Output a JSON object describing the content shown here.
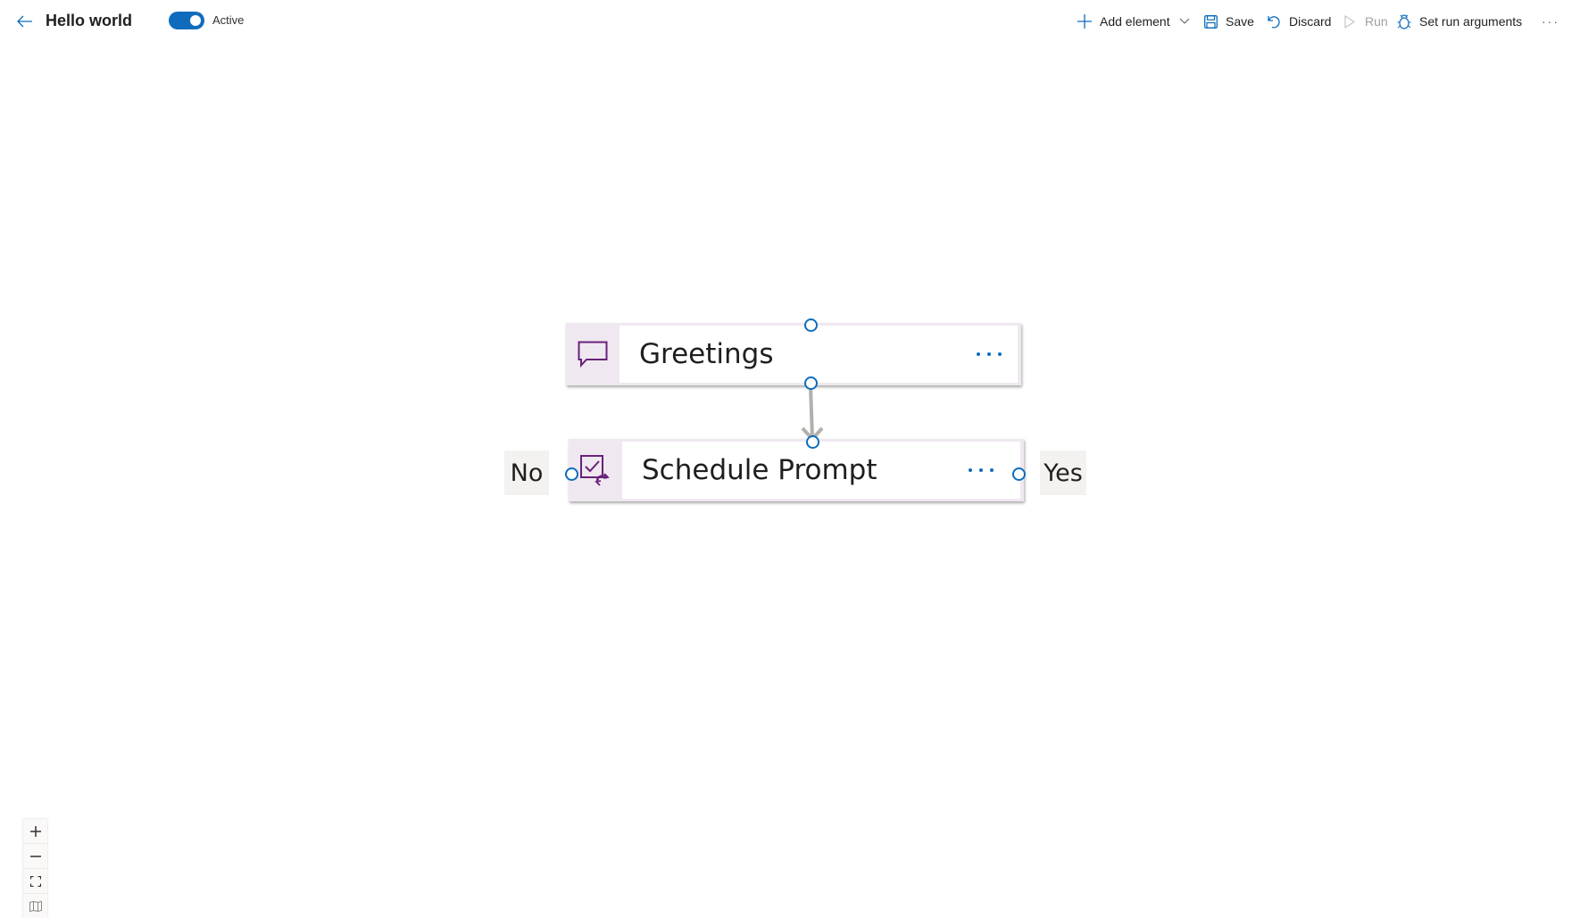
{
  "header": {
    "back_icon": "arrow-left-icon",
    "title": "Hello world",
    "toggle": {
      "label": "Active",
      "on": true
    }
  },
  "toolbar": {
    "add_element": {
      "label": "Add element",
      "icon": "plus-icon",
      "dropdown_icon": "chevron-down-icon"
    },
    "save": {
      "label": "Save",
      "icon": "save-icon"
    },
    "discard": {
      "label": "Discard",
      "icon": "undo-icon"
    },
    "run": {
      "label": "Run",
      "icon": "play-icon",
      "disabled": true
    },
    "set_run_arguments": {
      "label": "Set run arguments",
      "icon": "bug-icon"
    },
    "more": {
      "label": "···",
      "icon": "more-icon"
    }
  },
  "canvas": {
    "nodes": [
      {
        "id": "greetings",
        "label": "Greetings",
        "icon": "chat-bubble-icon"
      },
      {
        "id": "schedule_prompt",
        "label": "Schedule Prompt",
        "icon": "checkbox-sync-icon"
      }
    ],
    "edges": [
      {
        "from": "greetings",
        "to": "schedule_prompt"
      }
    ],
    "branches": {
      "no": "No",
      "yes": "Yes"
    }
  },
  "zoom_controls": [
    {
      "name": "zoom-in",
      "icon": "plus-icon"
    },
    {
      "name": "zoom-out",
      "icon": "minus-icon"
    },
    {
      "name": "fit-to-screen",
      "icon": "fit-screen-icon"
    },
    {
      "name": "minimap",
      "icon": "map-icon"
    }
  ],
  "colors": {
    "accent": "#0f6cbd",
    "node_icon": "#68217a",
    "node_bg": "#efe8f0",
    "edge": "#b3b0ad",
    "disabled_text": "#a19f9d"
  }
}
